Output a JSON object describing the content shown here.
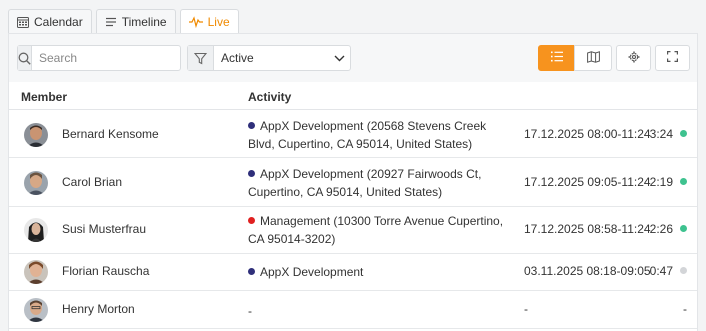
{
  "tabs": [
    {
      "label": "Calendar",
      "icon": "calendar-icon",
      "active": false
    },
    {
      "label": "Timeline",
      "icon": "timeline-icon",
      "active": false
    },
    {
      "label": "Live",
      "icon": "pulse-icon",
      "active": true
    }
  ],
  "toolbar": {
    "search_placeholder": "Search",
    "filter_value": "Active",
    "view_list_active": true
  },
  "colors": {
    "accent": "#f7931e",
    "appx_dot": "#2f2f7a",
    "management_dot": "#e02020",
    "online": "#3ec28f",
    "offline": "#d3d5d8"
  },
  "table": {
    "headers": {
      "member": "Member",
      "activity": "Activity"
    },
    "rows": [
      {
        "name": "Bernard Kensome",
        "activity": "AppX Development (20568 Stevens Creek Blvd, Cupertino, CA 95014, United States)",
        "activity_color": "#2f2f7a",
        "time": "17.12.2025 08:00-11:24",
        "duration": "3:24",
        "status": "online"
      },
      {
        "name": "Carol Brian",
        "activity": "AppX Development (20927 Fairwoods Ct, Cupertino, CA 95014, United States)",
        "activity_color": "#2f2f7a",
        "time": "17.12.2025 09:05-11:24",
        "duration": "2:19",
        "status": "online"
      },
      {
        "name": "Susi Musterfrau",
        "activity": "Management (10300 Torre Avenue Cupertino, CA 95014-3202)",
        "activity_color": "#e02020",
        "time": "17.12.2025 08:58-11:24",
        "duration": "2:26",
        "status": "online"
      },
      {
        "name": "Florian Rauscha",
        "activity": "AppX Development",
        "activity_color": "#2f2f7a",
        "time": "03.11.2025 08:18-09:05",
        "duration": "0:47",
        "status": "offline"
      },
      {
        "name": "Henry Morton",
        "activity": "-",
        "activity_color": "",
        "time": "-",
        "duration": "-",
        "status": "none"
      }
    ]
  }
}
